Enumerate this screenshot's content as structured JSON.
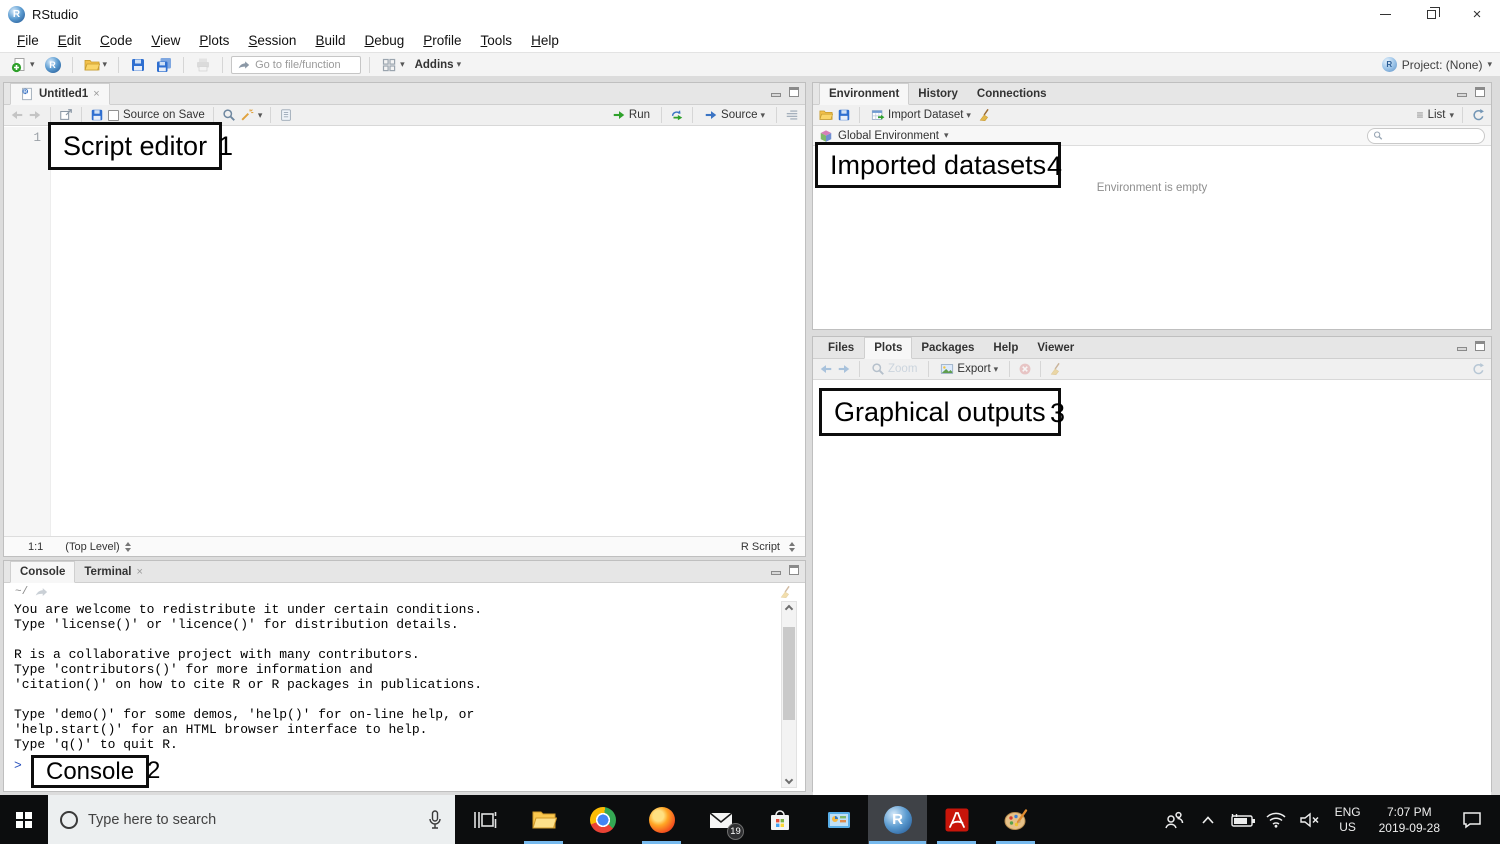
{
  "titlebar": {
    "title": "RStudio"
  },
  "menu": {
    "items": [
      "File",
      "Edit",
      "Code",
      "View",
      "Plots",
      "Session",
      "Build",
      "Debug",
      "Profile",
      "Tools",
      "Help"
    ]
  },
  "toolbar": {
    "goto_placeholder": "Go to file/function",
    "addins_label": "Addins",
    "project_label": "Project: (None)"
  },
  "source_pane": {
    "tab": "Untitled1",
    "source_on_save": "Source on Save",
    "run_label": "Run",
    "source_label": "Source",
    "line_number": "1",
    "status_cursor": "1:1",
    "status_scope": "(Top Level)",
    "status_type": "R Script"
  },
  "console_pane": {
    "tab_console": "Console",
    "tab_terminal": "Terminal",
    "path": "~/",
    "lines": [
      "You are welcome to redistribute it under certain conditions.",
      "Type 'license()' or 'licence()' for distribution details.",
      "",
      "R is a collaborative project with many contributors.",
      "Type 'contributors()' for more information and",
      "'citation()' on how to cite R or R packages in publications.",
      "",
      "Type 'demo()' for some demos, 'help()' for on-line help, or",
      "'help.start()' for an HTML browser interface to help.",
      "Type 'q()' to quit R."
    ],
    "prompt": ">"
  },
  "environment_pane": {
    "tabs": [
      "Environment",
      "History",
      "Connections"
    ],
    "import_label": "Import Dataset",
    "list_label": "List",
    "scope_label": "Global Environment",
    "empty_text": "Environment is empty"
  },
  "plots_pane": {
    "tabs": [
      "Files",
      "Plots",
      "Packages",
      "Help",
      "Viewer"
    ],
    "zoom_label": "Zoom",
    "export_label": "Export"
  },
  "annotations": {
    "script_editor": {
      "label": "Script editor",
      "num": "1"
    },
    "console": {
      "label": "Console",
      "num": "2"
    },
    "graphical": {
      "label": "Graphical outputs",
      "num": "3"
    },
    "imported": {
      "label": "Imported datasets",
      "num": "4"
    }
  },
  "taskbar": {
    "search_placeholder": "Type here to search",
    "mail_badge": "19",
    "lang_line1": "ENG",
    "lang_line2": "US",
    "time": "7:07 PM",
    "date": "2019-09-28"
  },
  "icons": {
    "close_glyph": "×",
    "dropdown_glyph": "▾",
    "list_glyph": "≡"
  },
  "colors": {
    "taskbar_underline": "#76b9ed",
    "prompt_blue": "#2a52bd",
    "annotation_border": "#0d0d0d",
    "rstudio_blue": "#1c4f8c"
  }
}
